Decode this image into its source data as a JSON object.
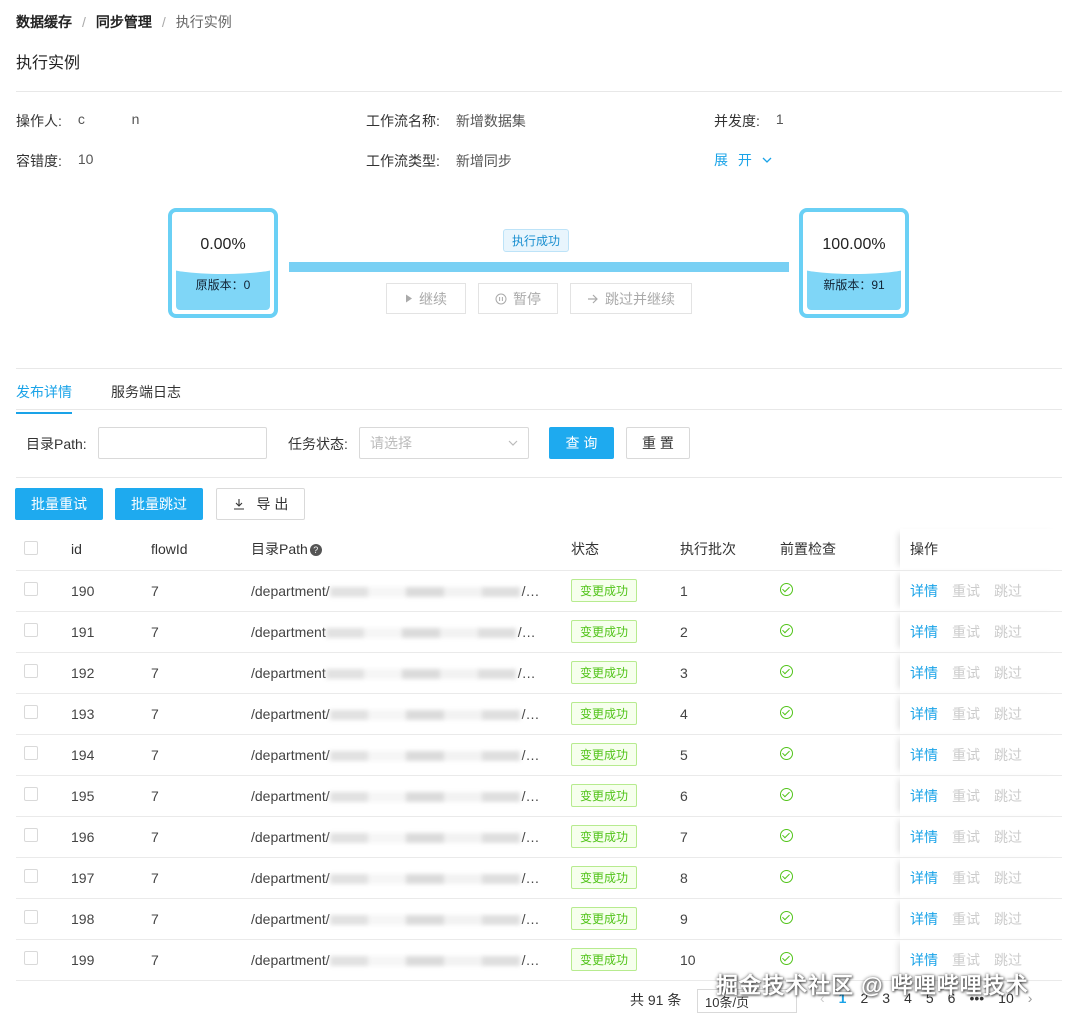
{
  "breadcrumb": [
    "数据缓存",
    "同步管理",
    "执行实例"
  ],
  "page_title": "执行实例",
  "info": {
    "operator_label": "操作人:",
    "operator_value": "c            n",
    "workflow_name_label": "工作流名称:",
    "workflow_name_value": "新增数据集",
    "concurrency_label": "并发度:",
    "concurrency_value": "1",
    "tolerance_label": "容错度:",
    "tolerance_value": "10",
    "workflow_type_label": "工作流类型:",
    "workflow_type_value": "新增同步",
    "expand_label": "展 开"
  },
  "progress": {
    "source_pct": "0.00%",
    "source_caption": "原版本：0",
    "target_pct": "100.00%",
    "target_caption": "新版本：91",
    "status_tag": "执行成功",
    "continue_label": "继续",
    "pause_label": "暂停",
    "skip_label": "跳过并继续"
  },
  "tabs": [
    "发布详情",
    "服务端日志"
  ],
  "filters": {
    "path_label": "目录Path:",
    "path_value": "",
    "status_label": "任务状态:",
    "status_placeholder": "请选择",
    "query_label": "查 询",
    "reset_label": "重 置"
  },
  "actions": {
    "batch_retry": "批量重试",
    "batch_skip": "批量跳过",
    "export": "导 出"
  },
  "table": {
    "headers": [
      "id",
      "flowId",
      "目录Path",
      "状态",
      "执行批次",
      "前置检查",
      "操作"
    ],
    "path_prefix": "/department",
    "status_text": "变更成功",
    "op_detail": "详情",
    "op_retry": "重试",
    "op_skip": "跳过",
    "rows": [
      {
        "id": "190",
        "flow": "7",
        "path": "/department/",
        "batch": "1"
      },
      {
        "id": "191",
        "flow": "7",
        "path": "/department",
        "batch": "2"
      },
      {
        "id": "192",
        "flow": "7",
        "path": "/department",
        "batch": "3"
      },
      {
        "id": "193",
        "flow": "7",
        "path": "/department/",
        "batch": "4"
      },
      {
        "id": "194",
        "flow": "7",
        "path": "/department/",
        "batch": "5"
      },
      {
        "id": "195",
        "flow": "7",
        "path": "/department/",
        "batch": "6"
      },
      {
        "id": "196",
        "flow": "7",
        "path": "/department/",
        "batch": "7"
      },
      {
        "id": "197",
        "flow": "7",
        "path": "/department/",
        "batch": "8"
      },
      {
        "id": "198",
        "flow": "7",
        "path": "/department/",
        "batch": "9"
      },
      {
        "id": "199",
        "flow": "7",
        "path": "/department/",
        "batch": "10"
      }
    ]
  },
  "pager": {
    "total": "共 91 条",
    "page_size": "10条/页",
    "pages": [
      "1",
      "2",
      "3",
      "4",
      "5",
      "6",
      "•••",
      "10"
    ],
    "current": "1"
  },
  "watermark": "掘金技术社区 @ 哔哩哔哩技术",
  "colors": {
    "accent": "#1aa3e8",
    "bucket": "#6ad0f5",
    "success": "#52c41a"
  }
}
